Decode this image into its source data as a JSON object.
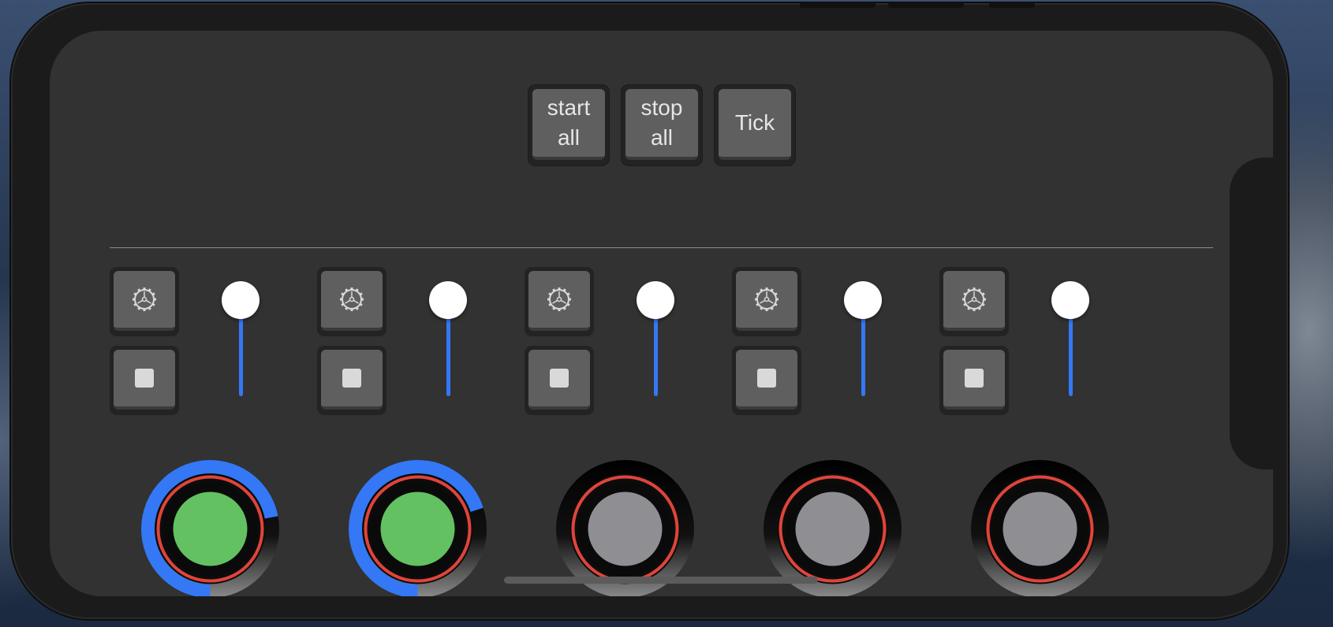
{
  "top_buttons": [
    {
      "label": "start\nall"
    },
    {
      "label": "stop\nall"
    },
    {
      "label": "Tick"
    }
  ],
  "colors": {
    "accent_blue": "#3478f6",
    "ring_red": "#e0443a",
    "active_green": "#63c162",
    "idle_gray": "#8e8e93"
  },
  "channels": [
    {
      "settings_icon": "gear-icon",
      "stop_icon": "stop-square-icon",
      "volume_fraction": 1.0,
      "progress_fraction": 0.72,
      "active": true
    },
    {
      "settings_icon": "gear-icon",
      "stop_icon": "stop-square-icon",
      "volume_fraction": 1.0,
      "progress_fraction": 0.7,
      "active": true
    },
    {
      "settings_icon": "gear-icon",
      "stop_icon": "stop-square-icon",
      "volume_fraction": 1.0,
      "progress_fraction": 0.0,
      "active": false
    },
    {
      "settings_icon": "gear-icon",
      "stop_icon": "stop-square-icon",
      "volume_fraction": 1.0,
      "progress_fraction": 0.0,
      "active": false
    },
    {
      "settings_icon": "gear-icon",
      "stop_icon": "stop-square-icon",
      "volume_fraction": 1.0,
      "progress_fraction": 0.0,
      "active": false
    }
  ]
}
